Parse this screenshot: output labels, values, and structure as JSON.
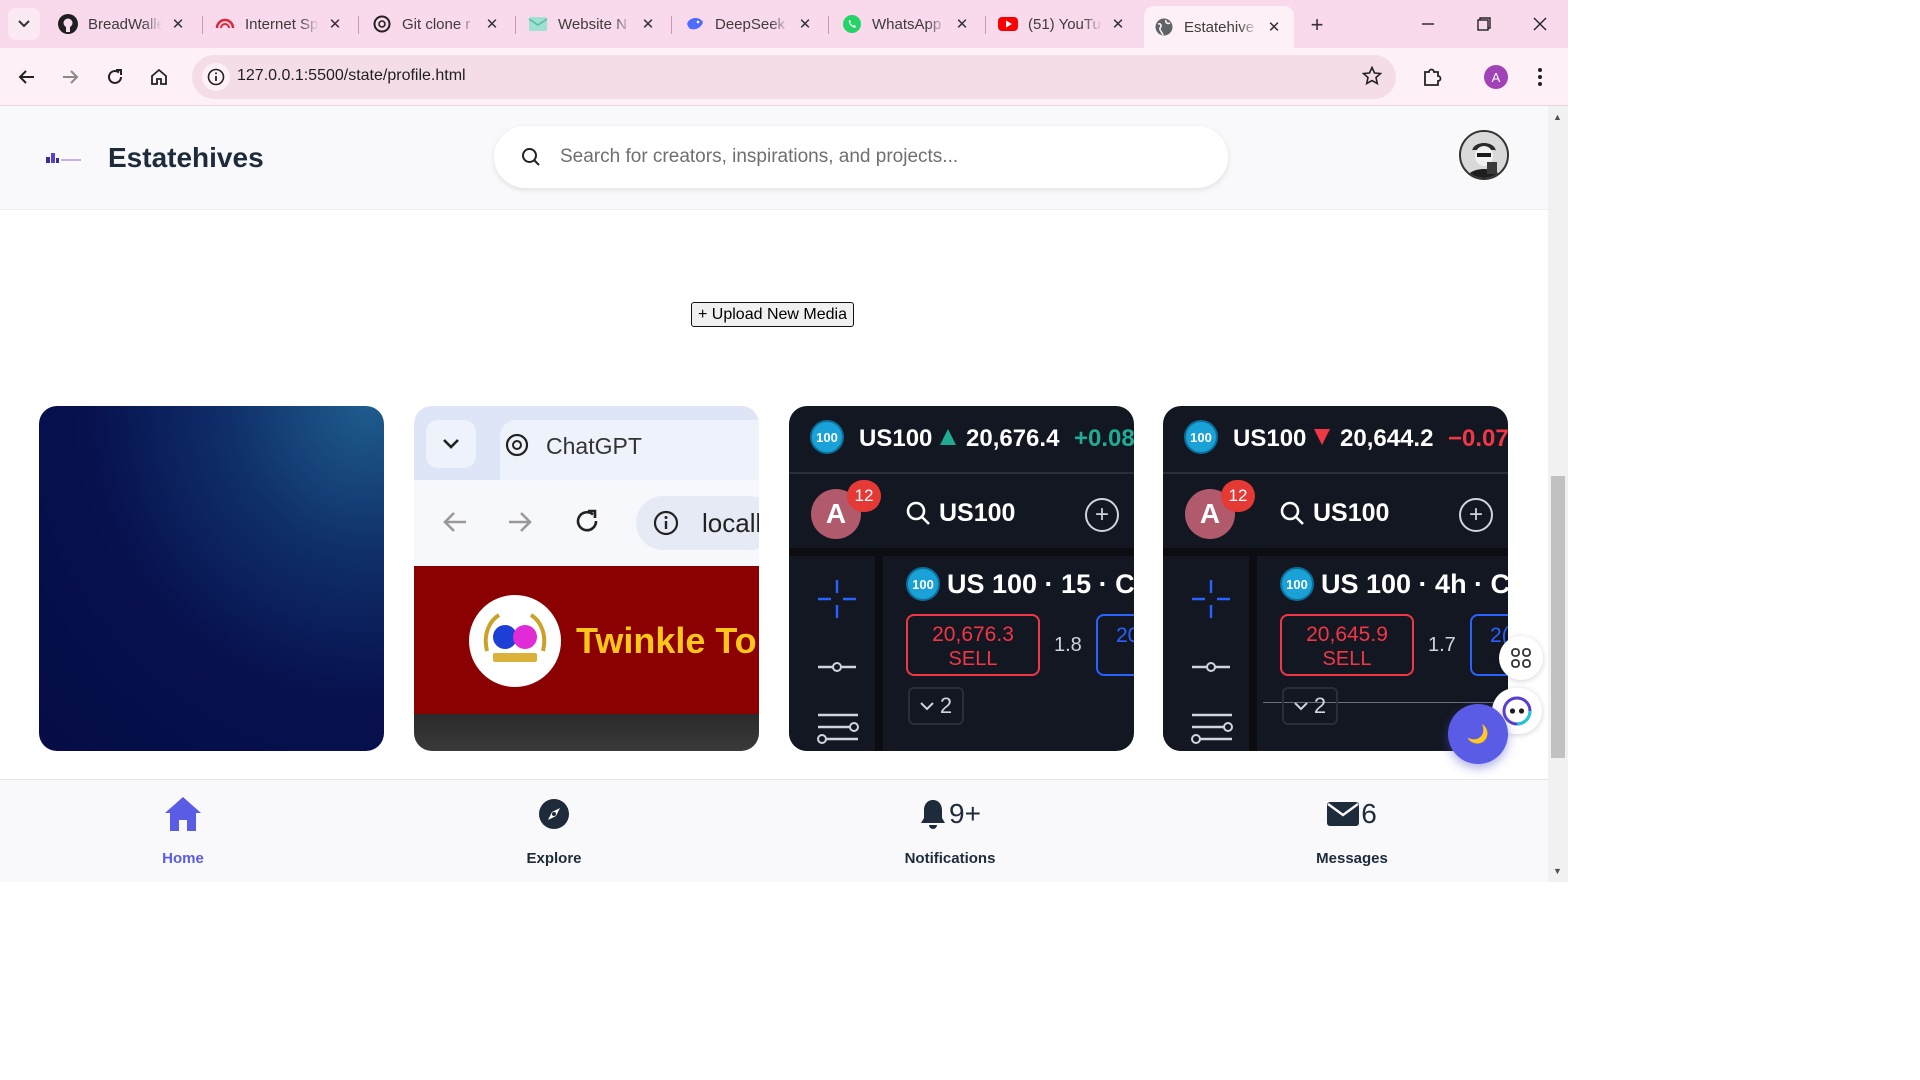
{
  "browser": {
    "tabs": [
      {
        "title": "BreadWalle",
        "icon": "github-icon"
      },
      {
        "title": "Internet Sp",
        "icon": "speedometer-icon"
      },
      {
        "title": "Git clone r",
        "icon": "chatgpt-icon"
      },
      {
        "title": "Website N",
        "icon": "website-icon"
      },
      {
        "title": "DeepSeek",
        "icon": "deepseek-icon"
      },
      {
        "title": "WhatsApp",
        "icon": "whatsapp-icon"
      },
      {
        "title": "(51) YouTu",
        "icon": "youtube-icon"
      },
      {
        "title": "Estatehive",
        "icon": "globe-icon",
        "active": true
      }
    ],
    "url": "127.0.0.1:5500/state/profile.html",
    "profile_initial": "A",
    "colors": {
      "tabstrip": "#f9d9ec",
      "toolbar": "#fdf0f6"
    }
  },
  "site": {
    "brand": "Estatehives",
    "search_placeholder": "Search for creators, inspirations, and projects...",
    "upload_label": "+ Upload New Media",
    "accent": "#5a5ce6"
  },
  "media": {
    "card2": {
      "tab_title": "ChatGPT",
      "omnibox_text": "locall",
      "banner_text": "Twinkle To"
    },
    "card3": {
      "badge": "100",
      "symbol": "US100",
      "direction": "up",
      "price": "20,676.4",
      "change": "+0.08",
      "change_color": "#22ab94",
      "avatar": "A",
      "notif": "12",
      "search": "US100",
      "title": "US 100 · 15 · C/",
      "sell_price": "20,676.3",
      "sell_label": "SELL",
      "spread": "1.8",
      "buy_partial": "20",
      "qty": "2"
    },
    "card4": {
      "badge": "100",
      "symbol": "US100",
      "direction": "down",
      "price": "20,644.2",
      "change": "−0.07",
      "change_color": "#f23645",
      "avatar": "A",
      "notif": "12",
      "search": "US100",
      "title": "US 100 · 4h · C/",
      "sell_price": "20,645.9",
      "sell_label": "SELL",
      "spread": "1.7",
      "buy_partial": "2(",
      "qty": "2"
    }
  },
  "bottom_nav": {
    "home": "Home",
    "explore": "Explore",
    "notifications": "Notifications",
    "notifications_count": "9+",
    "messages": "Messages",
    "messages_count": "6"
  },
  "theme_toggle_icon": "moon-icon"
}
